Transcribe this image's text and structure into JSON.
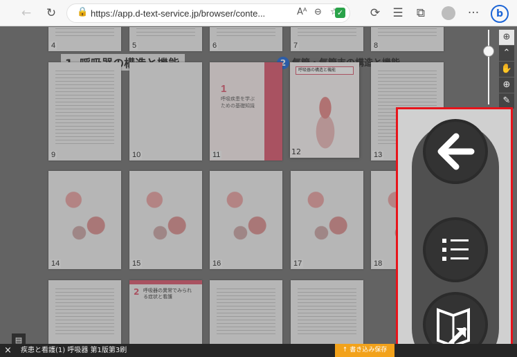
{
  "browser": {
    "url": "https://app.d-text-service.jp/browser/conte...",
    "icons": [
      "back-arrow-icon",
      "refresh-icon",
      "lock-icon",
      "read-aloud-icon",
      "zoom-icon",
      "favorite-add-icon",
      "shield-check-icon",
      "extension-icon",
      "favorites-icon",
      "collections-icon",
      "profile-icon",
      "more-icon",
      "bing-icon"
    ],
    "more_label": "···",
    "read_aloud_label": "Aᴬ",
    "bing_label": "b"
  },
  "viewer": {
    "section_1_number": "1",
    "section_1_title": "呼吸器の構造と機能",
    "section_2_number": "2",
    "section_2_title": "気管・気管支の構造と機能",
    "cover": {
      "number": "1",
      "text": "呼吸疾患を学ぶための基礎知識"
    },
    "highlight_header": "呼吸器の構造と機能",
    "page_numbers": {
      "row0": [
        "4",
        "5",
        "6",
        "7",
        "8"
      ],
      "row1": [
        "9",
        "10",
        "11",
        "12",
        "13"
      ],
      "row2": [
        "14",
        "15",
        "16",
        "17",
        "18"
      ]
    },
    "left_page_label": "12",
    "row3_page2_title": "呼吸器の異常でみられる症状と看護",
    "row3_page2_number": "2"
  },
  "statusbar": {
    "close_label": "×",
    "book_title": "疾患と看護(1)  呼吸器 第1版第3刷",
    "save_label": "↑ 書き込み保存"
  },
  "panel": {
    "buttons": [
      "back-arrow-icon",
      "list-icon",
      "book-jump-icon"
    ]
  }
}
